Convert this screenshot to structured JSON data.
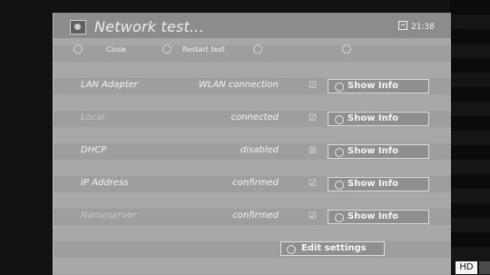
{
  "title": "Network test...",
  "clock": "21:38",
  "menu": {
    "close": "Close",
    "restart": "Restart test"
  },
  "rows": [
    {
      "label": "LAN Adapter",
      "value": "WLAN connection",
      "check": "☑",
      "button": "Show Info"
    },
    {
      "label": "Local",
      "value": "connected",
      "check": "☑",
      "button": "Show Info"
    },
    {
      "label": "DHCP",
      "value": "disabled",
      "check": "☒",
      "button": "Show Info"
    },
    {
      "label": "IP Address",
      "value": "confirmed",
      "check": "☑",
      "button": "Show Info"
    },
    {
      "label": "Nameserver",
      "value": "confirmed",
      "check": "☑",
      "button": "Show Info"
    }
  ],
  "edit_button": "Edit settings",
  "hd_badge": "HD"
}
